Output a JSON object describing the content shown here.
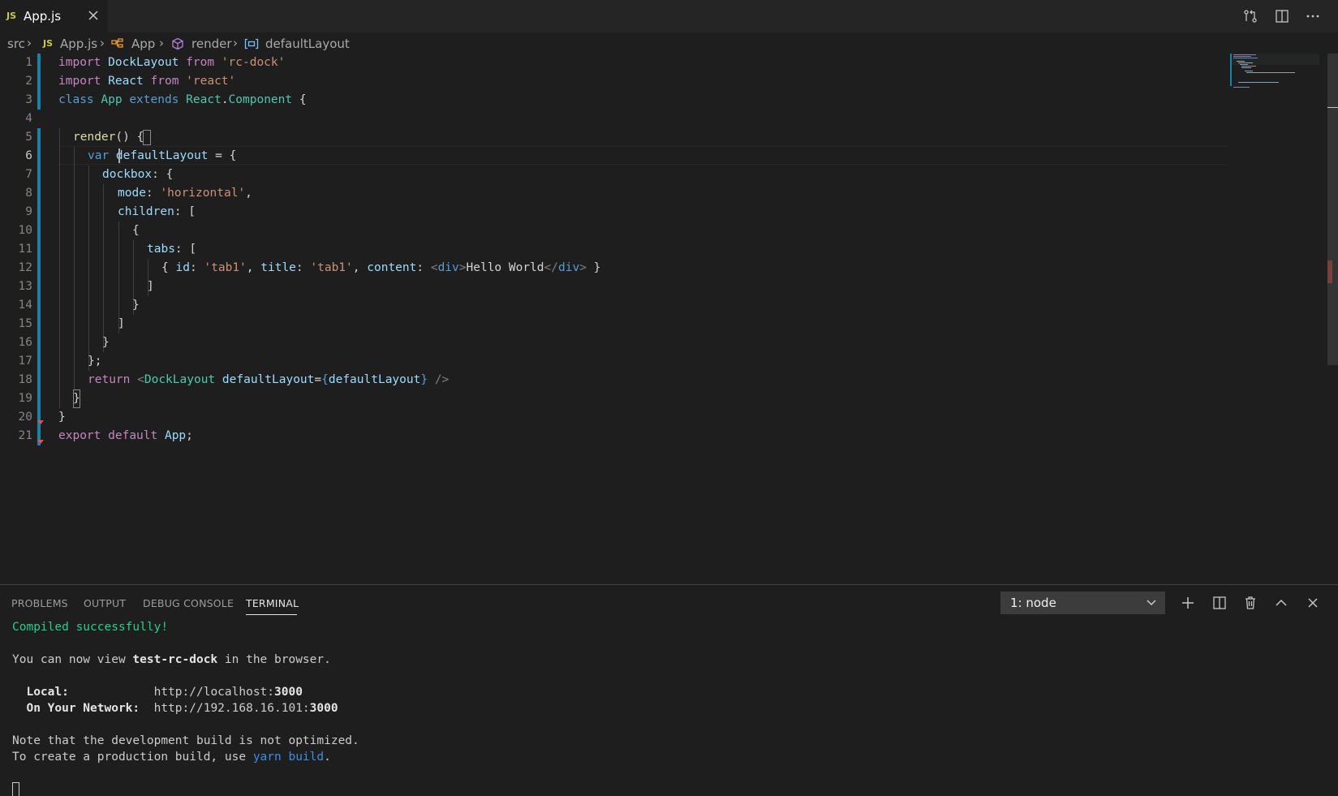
{
  "tab": {
    "badge": "JS",
    "filename": "App.js",
    "close": "✕"
  },
  "breadcrumb": {
    "items": [
      "src",
      "App.js",
      "App",
      "render",
      "defaultLayout"
    ],
    "js_badge": "JS",
    "sep": "›"
  },
  "editor": {
    "line_numbers": [
      "1",
      "2",
      "3",
      "4",
      "5",
      "6",
      "7",
      "8",
      "9",
      "10",
      "11",
      "12",
      "13",
      "14",
      "15",
      "16",
      "17",
      "18",
      "19",
      "20",
      "21"
    ],
    "active_line": "6",
    "code": {
      "l1": [
        "import",
        " DockLayout ",
        "from",
        " 'rc-dock'"
      ],
      "l2": [
        "import",
        " React ",
        "from",
        " 'react'"
      ],
      "l3": [
        "class",
        " App ",
        "extends",
        " React",
        ".",
        "Component",
        " {"
      ],
      "l5": [
        "render",
        "() {"
      ],
      "l6": [
        "var",
        " defaultLayout",
        " = {"
      ],
      "l7": [
        "dockbox",
        ": {"
      ],
      "l8": [
        "mode",
        ": ",
        "'horizontal'",
        ","
      ],
      "l9": [
        "children",
        ": ["
      ],
      "l10": "{",
      "l11": [
        "tabs",
        ": ["
      ],
      "l12": [
        "{ ",
        "id",
        ": ",
        "'tab1'",
        ", ",
        "title",
        ": ",
        "'tab1'",
        ", ",
        "content",
        ": ",
        "<",
        "div",
        ">",
        "Hello World",
        "</",
        "div",
        ">",
        " }"
      ],
      "l13": "]",
      "l14": "}",
      "l15": "]",
      "l16": "}",
      "l17": "};",
      "l18": [
        "return",
        " <",
        "DockLayout",
        " defaultLayout",
        "=",
        "{",
        "defaultLayout",
        "}",
        " />"
      ],
      "l19": "}",
      "l20": "}",
      "l21": [
        "export",
        " ",
        "default",
        " App",
        ";"
      ]
    }
  },
  "panel": {
    "tabs": [
      "PROBLEMS",
      "OUTPUT",
      "DEBUG CONSOLE",
      "TERMINAL"
    ],
    "active_tab": "TERMINAL",
    "terminal_select": "1: node",
    "terminal": {
      "l1": "Compiled successfully!",
      "l2": [
        "You can now view ",
        "test-rc-dock",
        " in the browser."
      ],
      "l3": [
        "  Local:",
        "            http://localhost:",
        "3000"
      ],
      "l4": [
        "  On Your Network:",
        "  http://192.168.16.101:",
        "3000"
      ],
      "l5": "Note that the development build is not optimized.",
      "l6": [
        "To create a production build, use ",
        "yarn build",
        "."
      ]
    }
  },
  "colors": {
    "editor_bg": "#1e1e1e",
    "tabbar_bg": "#252526",
    "keyword": "#569cd6",
    "control_keyword": "#c586c0",
    "string": "#ce9178",
    "type": "#4ec9b0",
    "variable": "#9cdcfe",
    "function": "#dcdcaa",
    "terminal_green": "#23d18b",
    "terminal_blue": "#3b8eea"
  },
  "icons": [
    "close-icon",
    "open-changes-icon",
    "split-editor-icon",
    "more-actions-icon",
    "class-icon",
    "method-icon",
    "variable-icon",
    "chevron-down-icon",
    "plus-icon",
    "split-terminal-icon",
    "trash-icon",
    "chevron-up-icon",
    "close-panel-icon"
  ]
}
